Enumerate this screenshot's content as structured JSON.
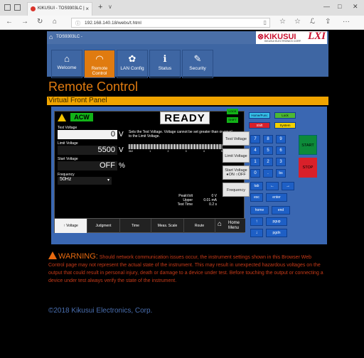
{
  "browser": {
    "tab_title": "KIKUSUI - TOS9303LC |",
    "tab_close": "×",
    "new_tab": "+",
    "tab_dropdown": "∨",
    "url": "192.168.140.18/webs/t.html",
    "back": "←",
    "forward": "→",
    "refresh": "↻",
    "home": "⌂",
    "star": "☆",
    "favorites": "☆",
    "sign": "ℒ",
    "share": "⇪",
    "more": "···",
    "minimize": "—",
    "maximize": "□",
    "close": "✕"
  },
  "header": {
    "model": "TOS9303LC -",
    "brand": "KIKUSUI",
    "brand_sub": "KIKUSUI ELECTRONICS CORP.",
    "lxi": "LXI"
  },
  "menu": [
    {
      "label": "Welcome",
      "icon": "home-icon",
      "glyph": "⌂"
    },
    {
      "label": "Remote Control",
      "icon": "gauge-icon",
      "glyph": "◠"
    },
    {
      "label": "LAN Config",
      "icon": "gear-icon",
      "glyph": "✿"
    },
    {
      "label": "Status",
      "icon": "info-icon",
      "glyph": "ℹ"
    },
    {
      "label": "Security",
      "icon": "wrench-icon",
      "glyph": "✎"
    }
  ],
  "page_title": "Remote Control",
  "panel_title": "Virtual Front Panel",
  "device": {
    "mode": "ACW",
    "status": "READY",
    "lock": "LOCK",
    "shift": "SHIFT",
    "test_voltage_label": "Test Voltage",
    "test_voltage_value": "0",
    "test_voltage_unit": "V",
    "limit_voltage_label": "Limit Voltage",
    "limit_voltage_value": "5500",
    "limit_voltage_unit": "V",
    "start_voltage_label": "Start Voltage",
    "start_voltage_value": "OFF",
    "start_voltage_unit": "%",
    "frequency_label": "Frequency",
    "frequency_value": "50Hz",
    "description": "Sets the Test Voltage. Voltage cannot be set greater than or equal to the Limit Voltage.",
    "scale_ticks": [
      "0kV",
      "1",
      "2",
      "3",
      "4",
      "5"
    ],
    "side_buttons": [
      "Test Voltage",
      "Limit Voltage",
      "Start Voltage",
      "Frequency"
    ],
    "start_voltage_toggle": "●ON  ○OFF",
    "readout_labels": "PeakVolt\nUpper\nTest Time",
    "readout_values": "0 V\n0.01 mA\n0.2 s",
    "bottom_buttons": [
      "↑ Voltage",
      "Judgment",
      "Time",
      "Meas. Scale",
      "Route"
    ],
    "home_label": "Home Menu"
  },
  "keypad": {
    "row0": [
      "Home/Func",
      "Lock"
    ],
    "row1": [
      "Shift",
      "System"
    ],
    "digits": [
      "7",
      "8",
      "9",
      "4",
      "5",
      "6",
      "1",
      "2",
      "3",
      "0",
      ".",
      "bs"
    ],
    "tab": "tab",
    "left": "←",
    "right": "→",
    "esc": "esc",
    "enter": "enter",
    "home": "home",
    "end": "end",
    "up": "↑",
    "pgup": "pgup",
    "down": "↓",
    "pgdn": "pgdn",
    "start": "START",
    "stop": "STOP"
  },
  "warning": {
    "title": "WARNING:",
    "text": "Should network communication issues occur, the instrument settings shown in this Browser Web Control page may not represent the actual state of the instrument. This may result in unexpected hazardous voltages on the output that could result in personal injury, death or damage to a device under test. Before touching the output or connecting a device under test always verify the state of the instrument."
  },
  "copyright": "©2018 Kikusui Electronics, Corp."
}
